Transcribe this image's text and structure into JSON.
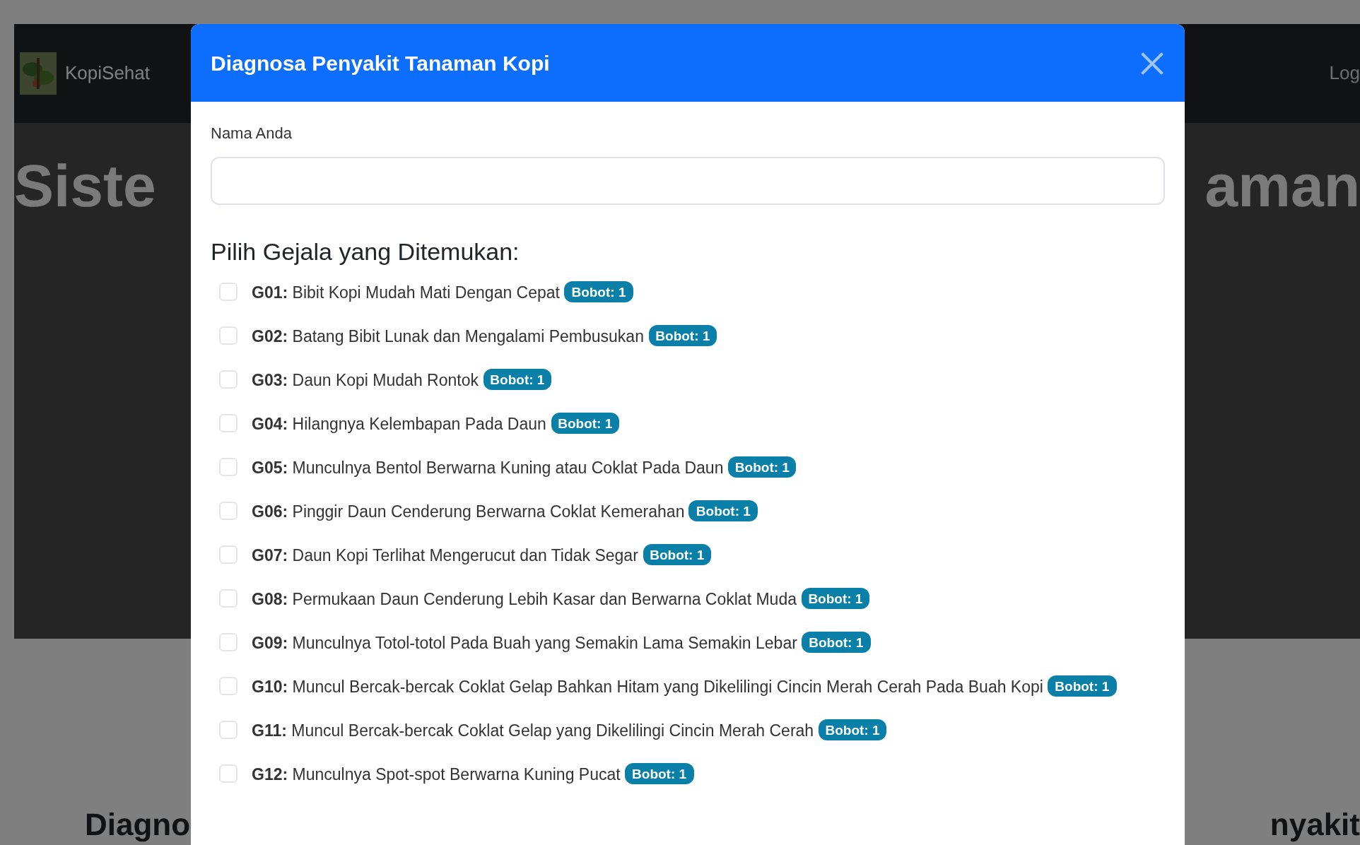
{
  "navbar": {
    "brand": "KopiSehat",
    "link": "Log"
  },
  "hero": {
    "title_left": "Siste",
    "title_right": "aman"
  },
  "section": {
    "heading_left": "Diagno",
    "heading_right": "nyakit"
  },
  "modal": {
    "title": "Diagnosa Penyakit Tanaman Kopi",
    "name_label": "Nama Anda",
    "symptoms_heading": "Pilih Gejala yang Ditemukan:",
    "symptoms": [
      {
        "text": "**G01:** Bibit Kopi Mudah Mati Dengan Cepat",
        "badge": "Bobot: 1",
        "checked": false
      },
      {
        "text": "**G02:** Batang Bibit Lunak dan Mengalami Pembusukan",
        "badge": "Bobot: 1",
        "checked": false
      },
      {
        "text": "**G03:** Daun Kopi Mudah Rontok",
        "badge": "Bobot: 1",
        "checked": false
      },
      {
        "text": "**G04:** Hilangnya Kelembapan Pada Daun",
        "badge": "Bobot: 1",
        "checked": false
      },
      {
        "text": "**G05:** Munculnya Bentol Berwarna Kuning atau Coklat Pada Daun",
        "badge": "Bobot: 1",
        "checked": false
      },
      {
        "text": "**G06:** Pinggir Daun Cenderung Berwarna Coklat Kemerahan",
        "badge": "Bobot: 1",
        "checked": false
      },
      {
        "text": "**G07:** Daun Kopi Terlihat Mengerucut dan Tidak Segar",
        "badge": "Bobot: 1",
        "checked": false
      },
      {
        "text": "**G08:** Permukaan Daun Cenderung Lebih Kasar dan Berwarna Coklat Muda",
        "badge": "Bobot: 1",
        "checked": false
      },
      {
        "text": "**G09:** Munculnya Totol-totol Pada Buah yang Semakin Lama Semakin Lebar",
        "badge": "Bobot: 1",
        "checked": false
      },
      {
        "text": "**G10:** Muncul Bercak-bercak Coklat Gelap Bahkan Hitam yang Dikelilingi Cincin Merah Cerah Pada Buah Kopi",
        "badge": "Bobot: 1",
        "checked": false
      },
      {
        "text": "**G11:** Muncul Bercak-bercak Coklat Gelap yang Dikelilingi Cincin Merah Cerah",
        "badge": "Bobot: 1",
        "checked": false
      },
      {
        "text": "**G12:** Munculnya Spot-spot Berwarna Kuning Pucat",
        "badge": "Bobot: 1",
        "checked": false
      }
    ]
  }
}
